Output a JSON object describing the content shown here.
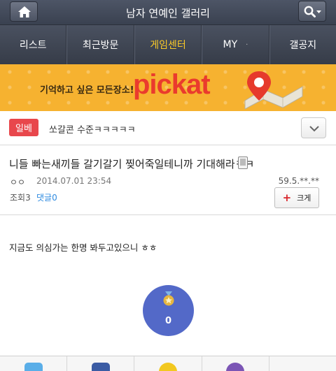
{
  "header": {
    "title": "남자 연예인 갤러리"
  },
  "nav": {
    "items": [
      {
        "label": "리스트"
      },
      {
        "label": "최근방문"
      },
      {
        "label": "게임센터"
      },
      {
        "label": "MY",
        "dot": "·"
      },
      {
        "label": "갤공지"
      }
    ],
    "active_color": "#f9c928"
  },
  "banner": {
    "slogan": "기억하고 싶은 모든장소!",
    "logo": "pickat"
  },
  "category": {
    "badge": "일베",
    "text": "쏘갈콘 수준ㅋㅋㅋㅋㅋ"
  },
  "article": {
    "title": "니들 빠는새끼들 갈기갈기 찢어죽일테니까 기대해라ㅋㅋ",
    "author": "ㅇㅇ",
    "date": "2014.07.01 23:54",
    "ip": "59.5.**.**",
    "views": "조회3",
    "comments": "댓글0",
    "big_button": "크게"
  },
  "content": {
    "text": "지금도 의심가는 한명 봐두고있으니 ㅎㅎ",
    "recommend_count": "0"
  },
  "colors": {
    "header_bg": "#3a4150",
    "badge_red": "#e8474c",
    "banner_bg": "#f6b230",
    "link_blue": "#2f8be0",
    "recommend_bg": "#5369c8"
  },
  "share": {
    "icons": [
      "twitter-icon",
      "facebook-icon",
      "kakaotalk-icon",
      "kakaostory-icon",
      "more-icon"
    ]
  }
}
